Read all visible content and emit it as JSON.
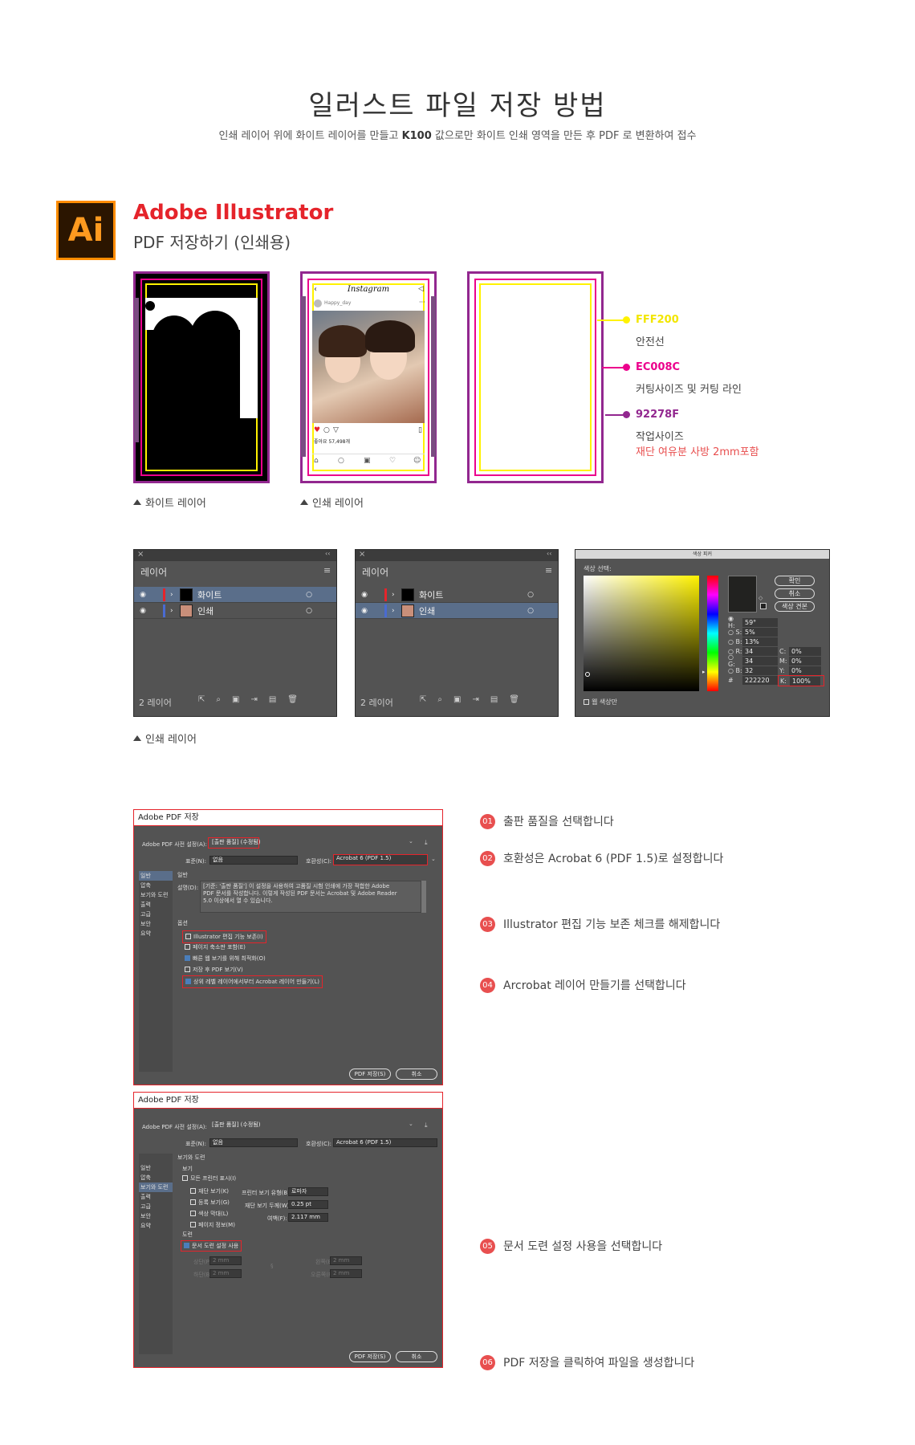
{
  "header": {
    "title": "일러스트 파일 저장 방법",
    "subtitle_pre": "인쇄 레이어 위에 화이트 레이어를 만들고",
    "subtitle_bold": "K100",
    "subtitle_post": "값으로만 화이트 인쇄 영역을 만든 후 PDF 로 변환하여 접수"
  },
  "app": {
    "logo": "Ai",
    "title": "Adobe Illustrator",
    "subtitle": "PDF 저장하기 (인쇄용)"
  },
  "mocks": {
    "white_caption": "화이트 레이어",
    "print_caption": "인쇄 레이어",
    "instagram": {
      "brand": "Instagram",
      "user": "Happy_day",
      "likes": "좋아요 57,498개"
    }
  },
  "legend": [
    {
      "code": "FFF200",
      "label": "안전선",
      "color": "#fff200"
    },
    {
      "code": "EC008C",
      "label": "커팅사이즈 및 커팅 라인",
      "color": "#ec008c"
    },
    {
      "code": "92278F",
      "label": "작업사이즈",
      "note": "재단 여유분 사방 2mm포함",
      "color": "#92278f"
    }
  ],
  "layers_panels": [
    {
      "title": "레이어",
      "rows": [
        "화이트",
        "인쇄"
      ],
      "footer": "2 레이어"
    },
    {
      "title": "레이어",
      "rows": [
        "화이트",
        "인쇄"
      ],
      "footer": "2 레이어"
    }
  ],
  "layers_caption": "인쇄 레이어",
  "color_picker": {
    "title": "색상 피커",
    "select_label": "색상 선택:",
    "ok": "확인",
    "cancel": "취소",
    "swatches": "색상 견본",
    "fields": [
      {
        "label": "H:",
        "value": "59°"
      },
      {
        "label": "S:",
        "value": "5%"
      },
      {
        "label": "B:",
        "value": "13%"
      },
      {
        "label": "R:",
        "value": "34"
      },
      {
        "label": "G:",
        "value": "34"
      },
      {
        "label": "B:",
        "value": "32"
      },
      {
        "label": "#",
        "value": "222220"
      }
    ],
    "cmyk": [
      {
        "label": "C:",
        "value": "0%"
      },
      {
        "label": "M:",
        "value": "0%"
      },
      {
        "label": "Y:",
        "value": "0%"
      },
      {
        "label": "K:",
        "value": "100%"
      }
    ],
    "web_only": "웹 색상만"
  },
  "pdf_dialog_1": {
    "title": "Adobe PDF 저장",
    "preset_label": "Adobe PDF 사전 설정(A):",
    "preset_value": "[출판 품질] (수정됨)",
    "standard_label": "표준(N):",
    "standard_value": "없음",
    "compat_label": "호환성(C):",
    "compat_value": "Acrobat 6 (PDF 1.5)",
    "sidebar": [
      "일반",
      "압축",
      "보기와 도련",
      "출력",
      "고급",
      "보안",
      "요약"
    ],
    "section_general": "일반",
    "desc_label": "설명(D):",
    "desc_text_1": "[기준: '출판 품질'] 이 설정을 사용하여 고품질 시험 인쇄에 가장 적합한 Adobe",
    "desc_text_2": "PDF 문서를 작성합니다. 이렇게 작성된 PDF 문서는 Acrobat 및 Adobe Reader",
    "desc_text_3": "5.0 이상에서 열 수 있습니다.",
    "section_options": "옵션",
    "options": [
      {
        "label": "Illustrator 편집 기능 보존(I)",
        "checked": false
      },
      {
        "label": "페이지 축소판 포함(E)",
        "checked": false
      },
      {
        "label": "빠른 웹 보기를 위해 최적화(O)",
        "checked": true
      },
      {
        "label": "저장 후 PDF 보기(V)",
        "checked": false
      },
      {
        "label": "상위 레벨 레이어에서부터 Acrobat 레이어 만들기(L)",
        "checked": true
      }
    ],
    "save_btn": "PDF 저장(S)",
    "cancel_btn": "취소"
  },
  "pdf_dialog_2": {
    "title": "Adobe PDF 저장",
    "preset_label": "Adobe PDF 사전 설정(A):",
    "preset_value": "[출판 품질] (수정됨)",
    "standard_label": "표준(N):",
    "standard_value": "없음",
    "compat_label": "호환성(C):",
    "compat_value": "Acrobat 6 (PDF 1.5)",
    "sidebar": [
      "일반",
      "압축",
      "보기와 도련",
      "출력",
      "고급",
      "보안",
      "요약"
    ],
    "section_marks": "보기와 도련",
    "section_view": "보기",
    "all_marks": "모든 프린터 표시(I)",
    "marks": [
      "재단 보기(K)",
      "등록 보기(G)",
      "색상 막대(L)",
      "페이지 정보(M)"
    ],
    "printer_type_label": "프린터 보기 유형(B):",
    "printer_type_value": "로마자",
    "weight_label": "재단 보기 두께(W):",
    "weight_value": "0.25 pt",
    "offset_label": "여백(F):",
    "offset_value": "2.117 mm",
    "section_bleed": "도련",
    "use_doc_bleed": "문서 도련 설정 사용",
    "bleed_top": "상단(P):",
    "bleed_bottom": "하단(B):",
    "bleed_left": "왼쪽(E):",
    "bleed_right": "오른쪽(R):",
    "bleed_value": "2 mm",
    "save_btn": "PDF 저장(S)",
    "cancel_btn": "취소"
  },
  "steps": [
    {
      "num": "01",
      "text": "출판 품질을 선택합니다"
    },
    {
      "num": "02",
      "text": "호환성은 Acrobat 6 (PDF 1.5)로 설정합니다"
    },
    {
      "num": "03",
      "text": "Illustrator 편집 기능 보존 체크를 해제합니다"
    },
    {
      "num": "04",
      "text": "Arcrobat 레이어 만들기를 선택합니다"
    },
    {
      "num": "05",
      "text": "문서 도련 설정 사용을 선택합니다"
    },
    {
      "num": "06",
      "text": "PDF 저장을 클릭하여 파일을 생성합니다"
    }
  ]
}
